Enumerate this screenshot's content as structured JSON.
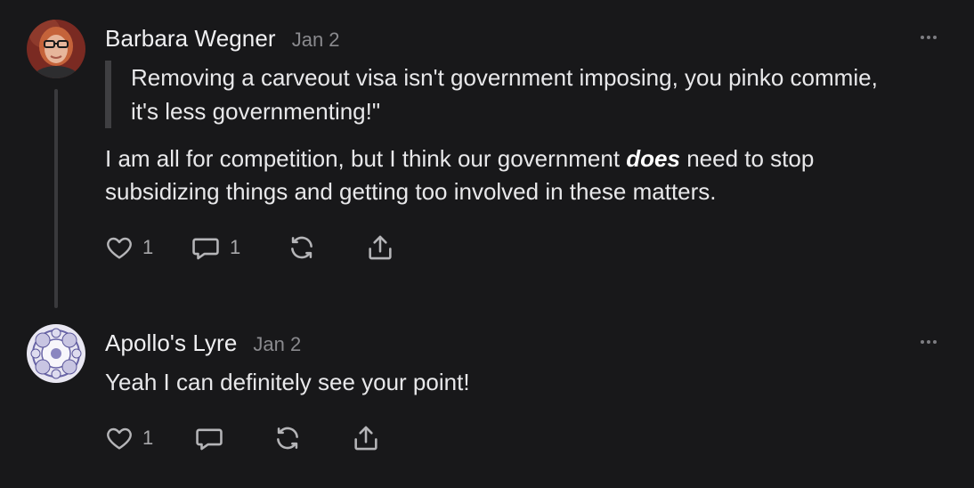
{
  "comments": [
    {
      "author": "Barbara Wegner",
      "date": "Jan 2",
      "quote_line1": "Removing a carveout visa isn't government imposing, you pinko commie,",
      "quote_line2": "it's less governmenting!\"",
      "body_line1_pre": "I am all for competition, but I think our government ",
      "body_line1_em": "does",
      "body_line1_post": " need to stop",
      "body_line2": "subsidizing things and getting too involved in these matters.",
      "like_count": "1",
      "reply_count": "1",
      "icons": [
        "heart-icon",
        "comment-icon",
        "restack-icon",
        "share-icon",
        "more-icon"
      ]
    },
    {
      "author": "Apollo's Lyre",
      "date": "Jan 2",
      "body": "Yeah I can definitely see your point!",
      "like_count": "1",
      "icons": [
        "heart-icon",
        "comment-icon",
        "restack-icon",
        "share-icon",
        "more-icon"
      ]
    }
  ],
  "colors": {
    "background": "#18181a",
    "text": "#e8e8ea",
    "muted": "#8a8a8e",
    "thread_line": "#3a3a3d"
  }
}
